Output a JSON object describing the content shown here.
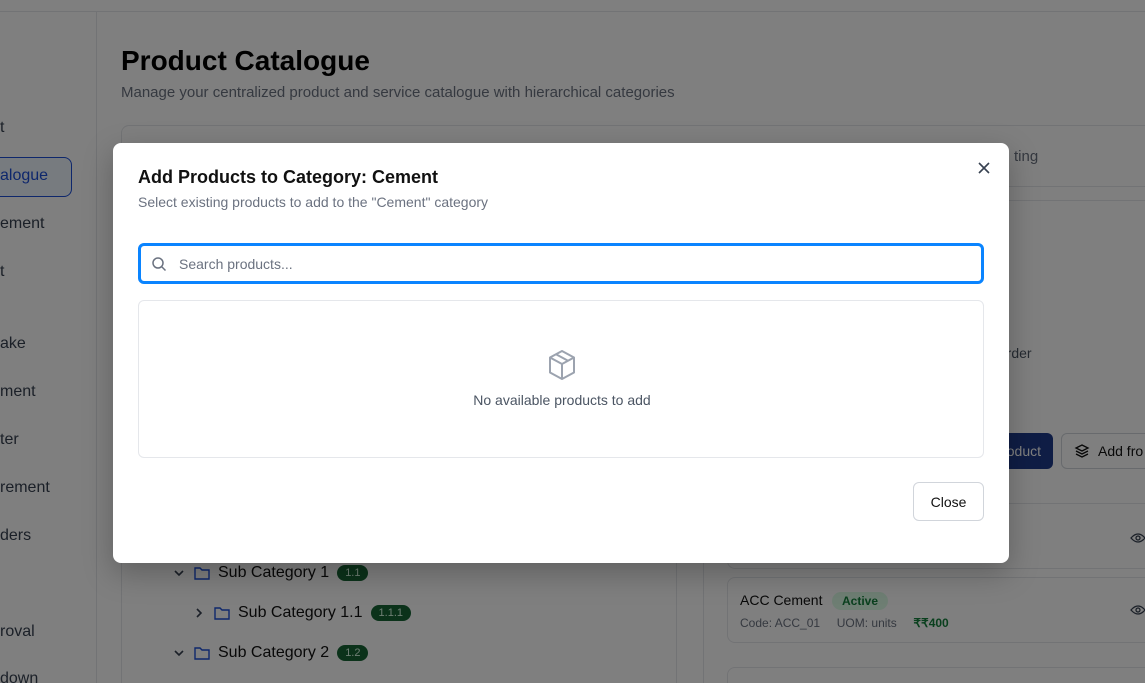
{
  "page": {
    "title": "Product Catalogue",
    "subtitle": "Manage your centralized product and service catalogue with hierarchical categories"
  },
  "sidebar": {
    "items": [
      {
        "label": "t",
        "active": false
      },
      {
        "label": "alogue",
        "active": true
      },
      {
        "label": "ement",
        "active": false
      },
      {
        "label": "t",
        "active": false
      },
      {
        "label": "ake",
        "active": false
      },
      {
        "label": "ment",
        "active": false
      },
      {
        "label": "ter",
        "active": false
      },
      {
        "label": "rement",
        "active": false
      },
      {
        "label": "ders",
        "active": false
      },
      {
        "label": "roval",
        "active": false
      },
      {
        "label": "down",
        "active": false
      }
    ]
  },
  "tabs": {
    "partial_right": "ting"
  },
  "category_tree": [
    {
      "label": "Sub Category 1",
      "badge": "1.1",
      "expanded": true
    },
    {
      "label": "Sub Category 1.1",
      "badge": "1.1.1",
      "expanded": false
    },
    {
      "label": "Sub Category 2",
      "badge": "1.2",
      "expanded": true
    }
  ],
  "right_panel": {
    "order_label": "t Order",
    "add_product_label": "oduct",
    "add_from_label": "Add fro"
  },
  "products": [
    {
      "name": "ACC Cement",
      "status": "Active",
      "code": "Code: ACC_01",
      "uom": "UOM: units",
      "price": "₹₹400"
    }
  ],
  "modal": {
    "title": "Add Products to Category: Cement",
    "description": "Select existing products to add to the \"Cement\" category",
    "search_placeholder": "Search products...",
    "empty_message": "No available products to add",
    "close_label": "Close"
  },
  "colors": {
    "accent": "#0a84ff",
    "primary": "#1e3a8a",
    "success": "#15803d",
    "overlay": "rgba(0,0,0,0.5)"
  }
}
